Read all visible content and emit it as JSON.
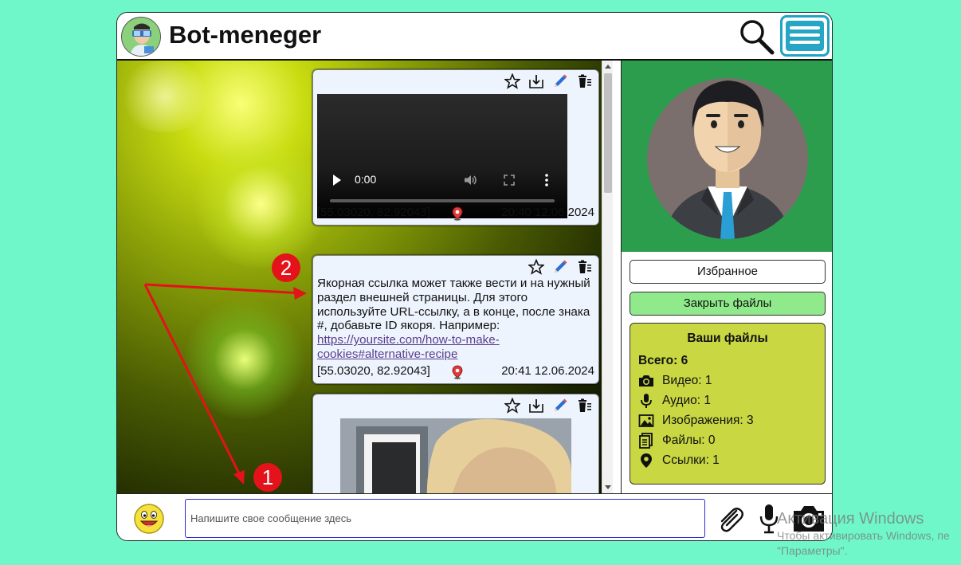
{
  "header": {
    "title": "Bot-meneger",
    "logo_icon": "bot-avatar-icon",
    "search_icon": "magnifier-icon",
    "menu_icon": "hamburger-menu-icon"
  },
  "messages": [
    {
      "type": "video",
      "video_time": "0:00",
      "coords": "[55.03020, 82.92043]",
      "timestamp": "20:40 12.06.2024",
      "tools": [
        "star-icon",
        "download-icon",
        "pencil-icon",
        "trash-icon"
      ]
    },
    {
      "type": "text",
      "text": "Якорная ссылка может также вести и на нужный раздел внешней страницы. Для этого используйте URL-ссылку, а в конце, после знака #, добавьте ID якоря. Например:",
      "link": "https://yoursite.com/how-to-make-cookies#alternative-recipe",
      "coords": "[55.03020, 82.92043]",
      "timestamp": "20:41 12.06.2024",
      "tools": [
        "star-icon",
        "pencil-icon",
        "trash-icon"
      ]
    },
    {
      "type": "image",
      "tools": [
        "star-icon",
        "download-icon",
        "pencil-icon",
        "trash-icon"
      ]
    }
  ],
  "annotations": {
    "n1": "1",
    "n2": "2",
    "color": "#e4121a"
  },
  "side": {
    "favorites_label": "Избранное",
    "close_files_label": "Закрыть файлы",
    "files": {
      "title": "Ваши файлы",
      "total": "Всего: 6",
      "rows": [
        {
          "icon": "camera-icon",
          "label": "Видео: 1"
        },
        {
          "icon": "microphone-icon",
          "label": "Аудио: 1"
        },
        {
          "icon": "image-icon",
          "label": "Изображения: 3"
        },
        {
          "icon": "document-icon",
          "label": "Файлы: 0"
        },
        {
          "icon": "location-pin-icon",
          "label": "Ссылки: 1"
        }
      ]
    }
  },
  "input": {
    "placeholder": "Напишите свое сообщение здесь",
    "value": ""
  },
  "watermark": {
    "line1": "Активация Windows",
    "line2": "Чтобы активировать Windows, пе",
    "line3": "\"Параметры\"."
  },
  "colors": {
    "page_bg": "#6ff7c9",
    "menu_accent": "#26a6c4",
    "avatar_bg": "#2c9c4d",
    "close_btn": "#90ea8b",
    "files_box": "#c8d742"
  }
}
